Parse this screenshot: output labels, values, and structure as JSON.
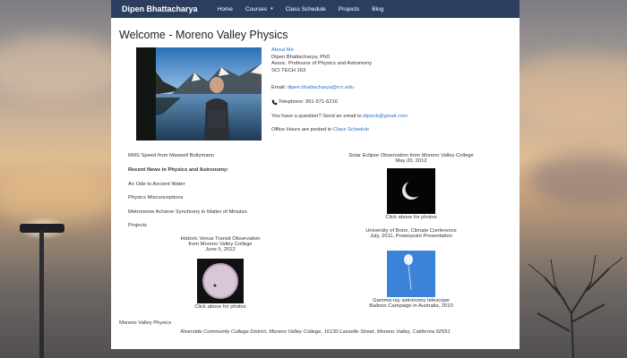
{
  "navbar": {
    "brand": "Dipen Bhattacharya",
    "items": [
      {
        "label": "Home"
      },
      {
        "label": "Courses"
      },
      {
        "label": "Class Schedule"
      },
      {
        "label": "Projects"
      },
      {
        "label": "Blog"
      }
    ],
    "courses_caret": "▾"
  },
  "page": {
    "title": "Welcome - Moreno Valley Physics"
  },
  "about": {
    "link": "About Me",
    "name": "Dipen Bhattacharya, PhD",
    "position": "Assoc. Professor of Physics and Astronomy",
    "office": "SCI TECH 163",
    "email_prefix": "Email: ",
    "email": "dipen.bhattacharya@rcc.edu",
    "telephone": "Telephone: 951-571-6216",
    "question_prefix": "You have a question? Send an email to ",
    "question_email": "dipenb@gmail.com",
    "hours_prefix": "Office Hours are posted in ",
    "hours_link": "Class Schedule"
  },
  "left": {
    "rms_link": "RMS Speed from Maxwell Boltzmann",
    "news_heading": "Recent News in Physics and Astronomy:",
    "news": [
      {
        "label": "An Ode to Ancient Water"
      },
      {
        "label": "Physics Misconceptions"
      },
      {
        "label": "Metronome Achieve Synchrony in Matter of Minutes"
      },
      {
        "label": "Projects"
      }
    ],
    "venus": {
      "line1": "Historic Venus Transit Observation",
      "line2": "from Moreno Valley College",
      "date": "June 5, 2012",
      "caption": "Click above for photos"
    }
  },
  "right": {
    "eclipse": {
      "title": "Solar Eclipse Observation from Moreno Valley College",
      "date": "May 20, 2012",
      "caption": "Click above for photos"
    },
    "bonn": {
      "line1": "University of Bonn, Climate Conference",
      "line2": "July, 2011, Powerpoint Presentation"
    },
    "balloon": {
      "line1": "Gamma-ray astronomy telescope",
      "line2": "Balloon Campaign in Australia, 2010"
    }
  },
  "footer": {
    "site": "Moreno Valley Physics",
    "address": "Riverside Community College District, Moreno Valley College, 16130 Lasselle Street, Moreno Valley, California 92551"
  },
  "colors": {
    "navbar": "#2c3e5f",
    "link": "#2a74c4",
    "text": "#333333"
  }
}
